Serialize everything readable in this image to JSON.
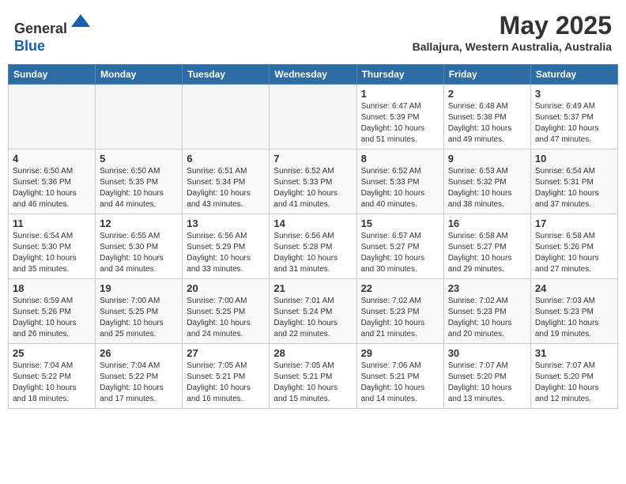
{
  "header": {
    "logo_line1": "General",
    "logo_line2": "Blue",
    "month_title": "May 2025",
    "location": "Ballajura, Western Australia, Australia"
  },
  "days_of_week": [
    "Sunday",
    "Monday",
    "Tuesday",
    "Wednesday",
    "Thursday",
    "Friday",
    "Saturday"
  ],
  "weeks": [
    [
      {
        "day": "",
        "info": ""
      },
      {
        "day": "",
        "info": ""
      },
      {
        "day": "",
        "info": ""
      },
      {
        "day": "",
        "info": ""
      },
      {
        "day": "1",
        "info": "Sunrise: 6:47 AM\nSunset: 5:39 PM\nDaylight: 10 hours\nand 51 minutes."
      },
      {
        "day": "2",
        "info": "Sunrise: 6:48 AM\nSunset: 5:38 PM\nDaylight: 10 hours\nand 49 minutes."
      },
      {
        "day": "3",
        "info": "Sunrise: 6:49 AM\nSunset: 5:37 PM\nDaylight: 10 hours\nand 47 minutes."
      }
    ],
    [
      {
        "day": "4",
        "info": "Sunrise: 6:50 AM\nSunset: 5:36 PM\nDaylight: 10 hours\nand 46 minutes."
      },
      {
        "day": "5",
        "info": "Sunrise: 6:50 AM\nSunset: 5:35 PM\nDaylight: 10 hours\nand 44 minutes."
      },
      {
        "day": "6",
        "info": "Sunrise: 6:51 AM\nSunset: 5:34 PM\nDaylight: 10 hours\nand 43 minutes."
      },
      {
        "day": "7",
        "info": "Sunrise: 6:52 AM\nSunset: 5:33 PM\nDaylight: 10 hours\nand 41 minutes."
      },
      {
        "day": "8",
        "info": "Sunrise: 6:52 AM\nSunset: 5:33 PM\nDaylight: 10 hours\nand 40 minutes."
      },
      {
        "day": "9",
        "info": "Sunrise: 6:53 AM\nSunset: 5:32 PM\nDaylight: 10 hours\nand 38 minutes."
      },
      {
        "day": "10",
        "info": "Sunrise: 6:54 AM\nSunset: 5:31 PM\nDaylight: 10 hours\nand 37 minutes."
      }
    ],
    [
      {
        "day": "11",
        "info": "Sunrise: 6:54 AM\nSunset: 5:30 PM\nDaylight: 10 hours\nand 35 minutes."
      },
      {
        "day": "12",
        "info": "Sunrise: 6:55 AM\nSunset: 5:30 PM\nDaylight: 10 hours\nand 34 minutes."
      },
      {
        "day": "13",
        "info": "Sunrise: 6:56 AM\nSunset: 5:29 PM\nDaylight: 10 hours\nand 33 minutes."
      },
      {
        "day": "14",
        "info": "Sunrise: 6:56 AM\nSunset: 5:28 PM\nDaylight: 10 hours\nand 31 minutes."
      },
      {
        "day": "15",
        "info": "Sunrise: 6:57 AM\nSunset: 5:27 PM\nDaylight: 10 hours\nand 30 minutes."
      },
      {
        "day": "16",
        "info": "Sunrise: 6:58 AM\nSunset: 5:27 PM\nDaylight: 10 hours\nand 29 minutes."
      },
      {
        "day": "17",
        "info": "Sunrise: 6:58 AM\nSunset: 5:26 PM\nDaylight: 10 hours\nand 27 minutes."
      }
    ],
    [
      {
        "day": "18",
        "info": "Sunrise: 6:59 AM\nSunset: 5:26 PM\nDaylight: 10 hours\nand 26 minutes."
      },
      {
        "day": "19",
        "info": "Sunrise: 7:00 AM\nSunset: 5:25 PM\nDaylight: 10 hours\nand 25 minutes."
      },
      {
        "day": "20",
        "info": "Sunrise: 7:00 AM\nSunset: 5:25 PM\nDaylight: 10 hours\nand 24 minutes."
      },
      {
        "day": "21",
        "info": "Sunrise: 7:01 AM\nSunset: 5:24 PM\nDaylight: 10 hours\nand 22 minutes."
      },
      {
        "day": "22",
        "info": "Sunrise: 7:02 AM\nSunset: 5:23 PM\nDaylight: 10 hours\nand 21 minutes."
      },
      {
        "day": "23",
        "info": "Sunrise: 7:02 AM\nSunset: 5:23 PM\nDaylight: 10 hours\nand 20 minutes."
      },
      {
        "day": "24",
        "info": "Sunrise: 7:03 AM\nSunset: 5:23 PM\nDaylight: 10 hours\nand 19 minutes."
      }
    ],
    [
      {
        "day": "25",
        "info": "Sunrise: 7:04 AM\nSunset: 5:22 PM\nDaylight: 10 hours\nand 18 minutes."
      },
      {
        "day": "26",
        "info": "Sunrise: 7:04 AM\nSunset: 5:22 PM\nDaylight: 10 hours\nand 17 minutes."
      },
      {
        "day": "27",
        "info": "Sunrise: 7:05 AM\nSunset: 5:21 PM\nDaylight: 10 hours\nand 16 minutes."
      },
      {
        "day": "28",
        "info": "Sunrise: 7:05 AM\nSunset: 5:21 PM\nDaylight: 10 hours\nand 15 minutes."
      },
      {
        "day": "29",
        "info": "Sunrise: 7:06 AM\nSunset: 5:21 PM\nDaylight: 10 hours\nand 14 minutes."
      },
      {
        "day": "30",
        "info": "Sunrise: 7:07 AM\nSunset: 5:20 PM\nDaylight: 10 hours\nand 13 minutes."
      },
      {
        "day": "31",
        "info": "Sunrise: 7:07 AM\nSunset: 5:20 PM\nDaylight: 10 hours\nand 12 minutes."
      }
    ]
  ]
}
